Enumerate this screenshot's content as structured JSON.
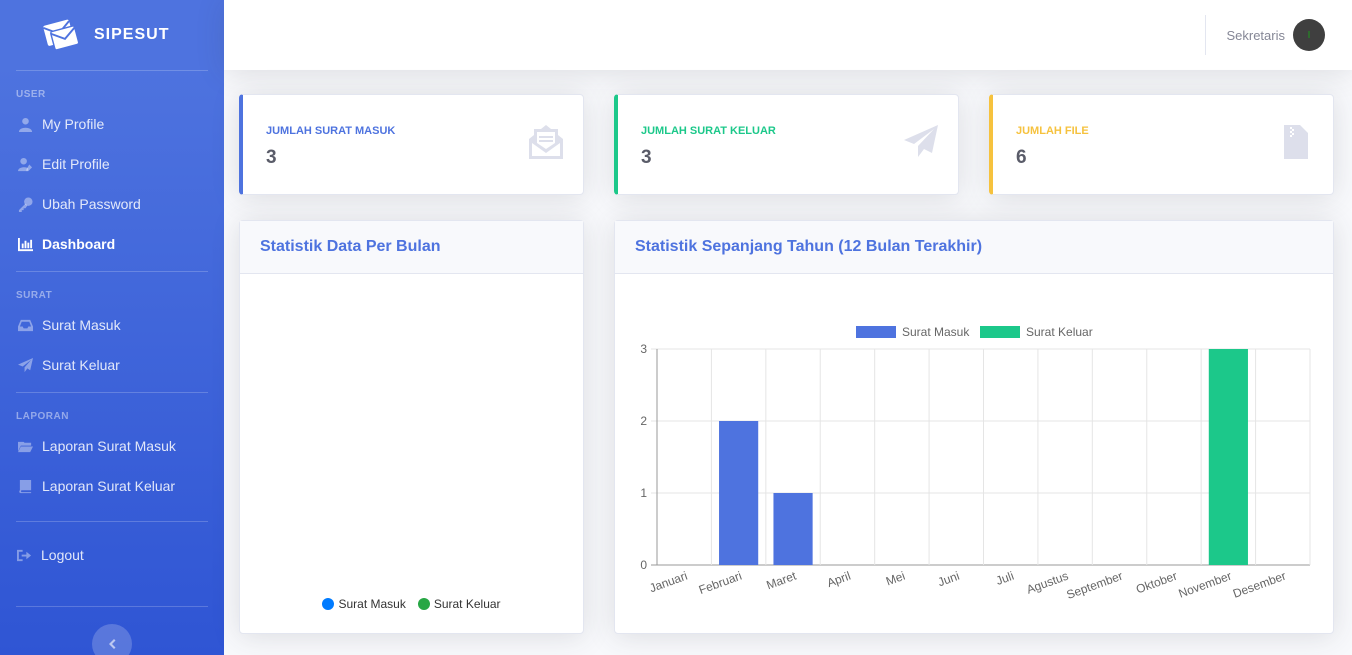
{
  "brand": {
    "name": "SIPESUT"
  },
  "sidebar": {
    "sections": [
      {
        "heading": "USER",
        "items": [
          {
            "label": "My Profile",
            "icon": "user-icon",
            "active": false
          },
          {
            "label": "Edit Profile",
            "icon": "user-edit-icon",
            "active": false
          },
          {
            "label": "Ubah Password",
            "icon": "key-icon",
            "active": false
          },
          {
            "label": "Dashboard",
            "icon": "chart-bar-icon",
            "active": true
          }
        ]
      },
      {
        "heading": "SURAT",
        "items": [
          {
            "label": "Surat Masuk",
            "icon": "inbox-icon",
            "active": false
          },
          {
            "label": "Surat Keluar",
            "icon": "paper-plane-icon",
            "active": false
          }
        ]
      },
      {
        "heading": "LAPORAN",
        "items": [
          {
            "label": "Laporan Surat Masuk",
            "icon": "folder-open-icon",
            "active": false
          },
          {
            "label": "Laporan Surat Keluar",
            "icon": "book-icon",
            "active": false
          }
        ]
      }
    ],
    "logout_label": "Logout"
  },
  "topbar": {
    "user_name": "Sekretaris"
  },
  "stats": {
    "masuk": {
      "label": "JUMLAH SURAT MASUK",
      "value": "3",
      "icon": "envelope-open-text-icon"
    },
    "keluar": {
      "label": "JUMLAH SURAT KELUAR",
      "value": "3",
      "icon": "paper-plane-icon"
    },
    "file": {
      "label": "JUMLAH FILE",
      "value": "6",
      "icon": "file-archive-icon"
    }
  },
  "pie_card": {
    "title": "Statistik Data Per Bulan",
    "legend": [
      {
        "name": "Surat Masuk",
        "color": "#007bff"
      },
      {
        "name": "Surat Keluar",
        "color": "#28a745"
      }
    ]
  },
  "bar_card": {
    "title": "Statistik Sepanjang Tahun (12 Bulan Terakhir)"
  },
  "chart_data": {
    "type": "bar",
    "categories": [
      "Januari",
      "Februari",
      "Maret",
      "April",
      "Mei",
      "Juni",
      "Juli",
      "Agustus",
      "September",
      "Oktober",
      "November",
      "Desember"
    ],
    "series": [
      {
        "name": "Surat Masuk",
        "color": "#4e73df",
        "values": [
          0,
          2,
          1,
          0,
          0,
          0,
          0,
          0,
          0,
          0,
          0,
          0
        ]
      },
      {
        "name": "Surat Keluar",
        "color": "#1cc88a",
        "values": [
          0,
          0,
          0,
          0,
          0,
          0,
          0,
          0,
          0,
          0,
          3,
          0
        ]
      }
    ],
    "ylim": [
      0,
      3
    ],
    "yticks": [
      0,
      1,
      2,
      3
    ],
    "grid": true,
    "legend_position": "top"
  }
}
